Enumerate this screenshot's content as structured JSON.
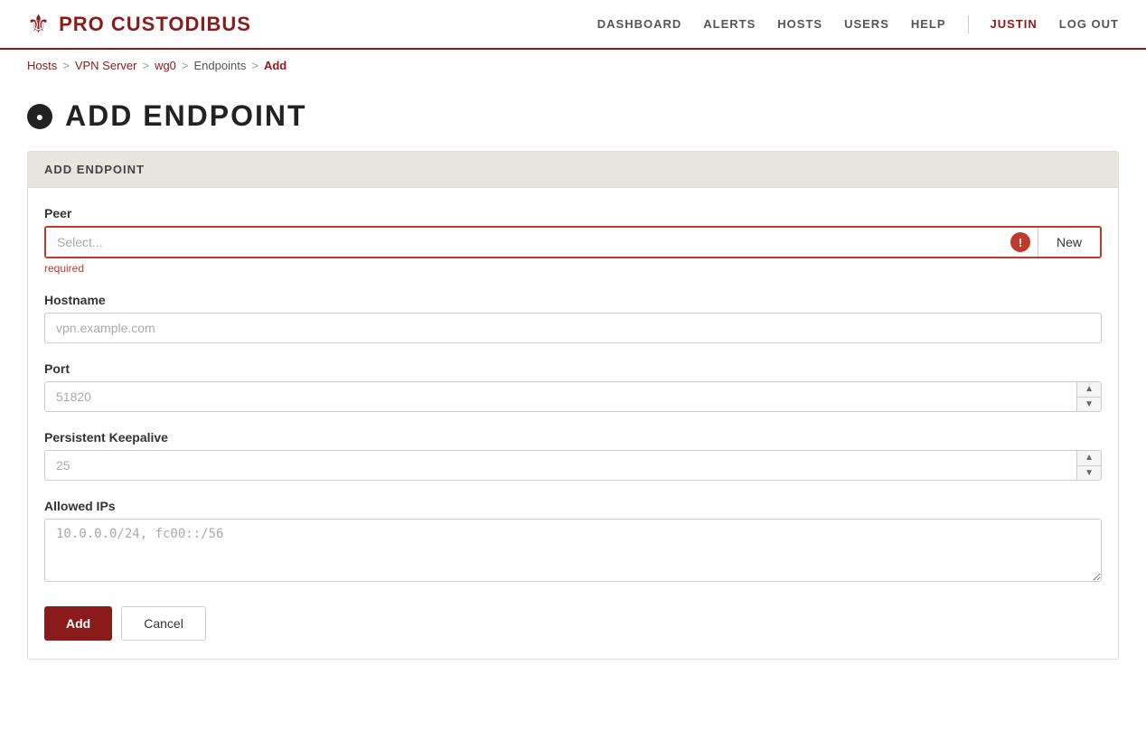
{
  "header": {
    "logo_text": "PRO CUSTODIBUS",
    "nav_items": [
      {
        "label": "DASHBOARD",
        "href": "#"
      },
      {
        "label": "ALERTS",
        "href": "#"
      },
      {
        "label": "HOSTS",
        "href": "#"
      },
      {
        "label": "USERS",
        "href": "#"
      },
      {
        "label": "HELP",
        "href": "#"
      }
    ],
    "user": "JUSTIN",
    "logout": "LOG OUT"
  },
  "breadcrumb": {
    "items": [
      {
        "label": "Hosts",
        "href": "#",
        "active": true
      },
      {
        "label": "VPN Server",
        "href": "#",
        "active": true
      },
      {
        "label": "wg0",
        "href": "#",
        "active": true
      },
      {
        "label": "Endpoints",
        "href": "#",
        "active": false
      },
      {
        "label": "Add",
        "href": "#",
        "active": false
      }
    ]
  },
  "page": {
    "title": "ADD ENDPOINT",
    "card_header": "ADD ENDPOINT"
  },
  "form": {
    "peer_label": "Peer",
    "peer_placeholder": "Select...",
    "peer_required": "required",
    "peer_new_button": "New",
    "hostname_label": "Hostname",
    "hostname_placeholder": "vpn.example.com",
    "port_label": "Port",
    "port_placeholder": "51820",
    "keepalive_label": "Persistent Keepalive",
    "keepalive_placeholder": "25",
    "allowed_ips_label": "Allowed IPs",
    "allowed_ips_placeholder": "10.0.0.0/24, fc00::/56",
    "add_button": "Add",
    "cancel_button": "Cancel"
  }
}
